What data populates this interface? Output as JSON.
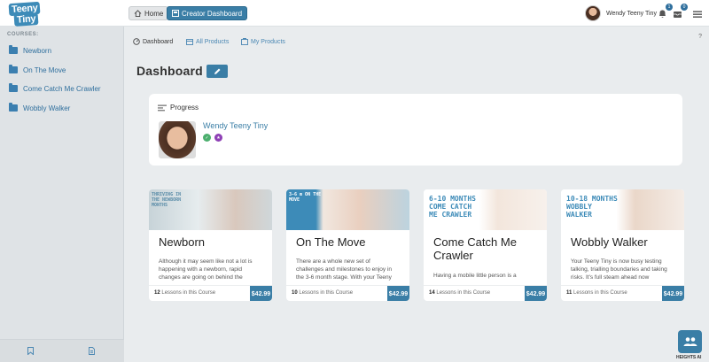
{
  "logo": {
    "line1": "Teeny",
    "line2": "Tiny"
  },
  "topbar": {
    "home_label": "Home",
    "creator_label": "Creator Dashboard",
    "user_name": "Wendy Teeny Tiny",
    "notifications_count": "1",
    "messages_count": "0"
  },
  "sidebar": {
    "heading": "COURSES:",
    "items": [
      {
        "label": "Newborn"
      },
      {
        "label": "On The Move"
      },
      {
        "label": "Come Catch Me Crawler"
      },
      {
        "label": "Wobbly Walker"
      }
    ]
  },
  "subnav": {
    "dashboard": "Dashboard",
    "all_products": "All Products",
    "my_products": "My Products",
    "help": "?"
  },
  "page": {
    "title": "Dashboard"
  },
  "progress": {
    "title": "Progress",
    "user_name": "Wendy Teeny Tiny"
  },
  "courses": [
    {
      "tag": "THRIVING IN THE NEWBORN MONTHS",
      "title": "Newborn",
      "desc": "Although it may seem like not a lot is happening with a newborn, rapid changes are going on behind the",
      "lessons": "12",
      "lessons_label": "Lessons in this Course",
      "price": "$42.99"
    },
    {
      "tag": "3-6 m ON THE MOVE",
      "title": "On The Move",
      "desc": "There are a whole new set of challenges and milestones to enjoy in the 3-6 month stage. With your Teeny",
      "lessons": "10",
      "lessons_label": "Lessons in this Course",
      "price": "$42.99"
    },
    {
      "tag": "6-10 MONTHS COME CATCH ME CRAWLER",
      "title": "Come Catch Me Crawler",
      "desc": "Having a mobile little person is a",
      "lessons": "14",
      "lessons_label": "Lessons in this Course",
      "price": "$42.99"
    },
    {
      "tag": "10-18 MONTHS WOBBLY WALKER",
      "title": "Wobbly Walker",
      "desc": "Your Teeny Tiny is now busy testing talking, trialling boundaries and taking risks. It's full steam ahead now",
      "lessons": "11",
      "lessons_label": "Lessons in this Course",
      "price": "$42.99"
    }
  ],
  "widget": {
    "label": "HEIGHTS AI"
  },
  "colors": {
    "accent": "#3a7ea6",
    "link": "#4a87b3",
    "sidebar_bg": "#dfe3e6",
    "page_bg": "#e9ecee"
  }
}
